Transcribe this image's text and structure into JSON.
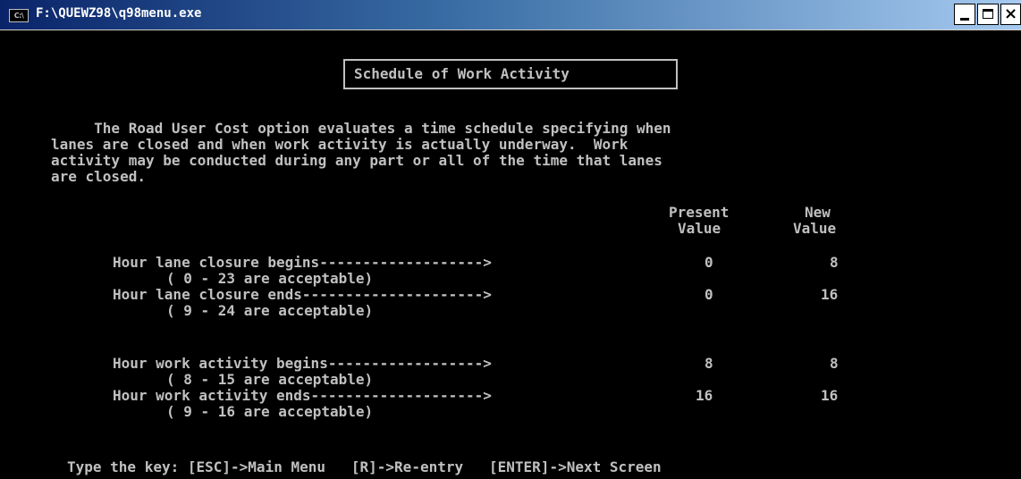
{
  "window": {
    "title": "F:\\QUEWZ98\\q98menu.exe",
    "icon": "console-icon",
    "icon_text": "C:\\",
    "controls": {
      "close_glyph": "×"
    }
  },
  "screen": {
    "heading": "Schedule of Work Activity",
    "intro": [
      "     The Road User Cost option evaluates a time schedule specifying when",
      "lanes are closed and when work activity is actually underway.  Work",
      "activity may be conducted during any part or all of the time that lanes",
      "are closed."
    ],
    "columns": {
      "present_1": "Present",
      "present_2": "Value",
      "new_1": "New",
      "new_2": "Value"
    },
    "rows": [
      {
        "label": "Hour lane closure begins------------------->",
        "range": "( 0 - 23 are acceptable)",
        "present": "0",
        "new": "8"
      },
      {
        "label": "Hour lane closure ends--------------------->",
        "range": "( 9 - 24 are acceptable)",
        "present": "0",
        "new": "16"
      },
      {
        "label": "Hour work activity begins------------------>",
        "range": "( 8 - 15 are acceptable)",
        "present": "8",
        "new": "8"
      },
      {
        "label": "Hour work activity ends-------------------->",
        "range": "( 9 - 16 are acceptable)",
        "present": "16",
        "new": "16"
      }
    ],
    "footer": "Type the key: [ESC]->Main Menu   [R]->Re-entry   [ENTER]->Next Screen"
  },
  "colors": {
    "console_bg": "#000000",
    "console_fg": "#c0c0c0",
    "titlebar_start": "#0a246a",
    "titlebar_end": "#a6caf0"
  }
}
